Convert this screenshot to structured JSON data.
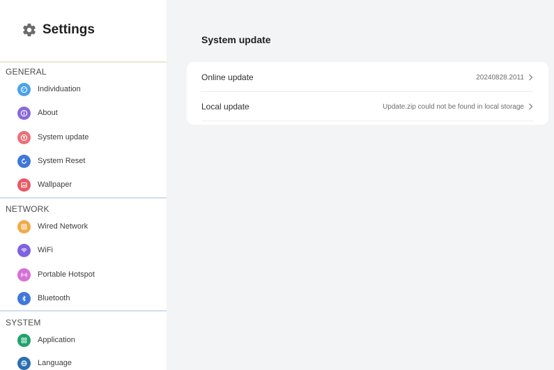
{
  "sidebar": {
    "title": "Settings",
    "header_icon": "gear-icon",
    "sections": [
      {
        "label": "GENERAL",
        "items": [
          {
            "label": "Individuation",
            "icon": "palette-icon",
            "color": "#4aa3e8"
          },
          {
            "label": "About",
            "icon": "info-icon",
            "color": "#8a6ad6"
          },
          {
            "label": "System update",
            "icon": "upload-icon",
            "color": "#e9717a"
          },
          {
            "label": "System Reset",
            "icon": "reset-icon",
            "color": "#3f78d9"
          },
          {
            "label": "Wallpaper",
            "icon": "image-icon",
            "color": "#e85a66"
          }
        ]
      },
      {
        "label": "NETWORK",
        "items": [
          {
            "label": "Wired Network",
            "icon": "ethernet-icon",
            "color": "#f2a94b"
          },
          {
            "label": "WiFi",
            "icon": "wifi-icon",
            "color": "#7e62e0"
          },
          {
            "label": "Portable Hotspot",
            "icon": "hotspot-icon",
            "color": "#d670d6"
          },
          {
            "label": "Bluetooth",
            "icon": "bluetooth-icon",
            "color": "#3f78d9"
          }
        ]
      },
      {
        "label": "SYSTEM",
        "items": [
          {
            "label": "Application",
            "icon": "apps-icon",
            "color": "#1fa36a"
          },
          {
            "label": "Language",
            "icon": "globe-icon",
            "color": "#2b6fb0"
          }
        ]
      }
    ]
  },
  "main": {
    "title": "System update",
    "rows": [
      {
        "label": "Online update",
        "value": "20240828.2011"
      },
      {
        "label": "Local update",
        "value": "Update.zip could not be found in local storage"
      }
    ]
  },
  "colors": {
    "divider_general": "#ece6d2",
    "divider_network": "#cfe0ee",
    "divider_system": "#cfe0ee",
    "background": "#f3f4f6"
  }
}
